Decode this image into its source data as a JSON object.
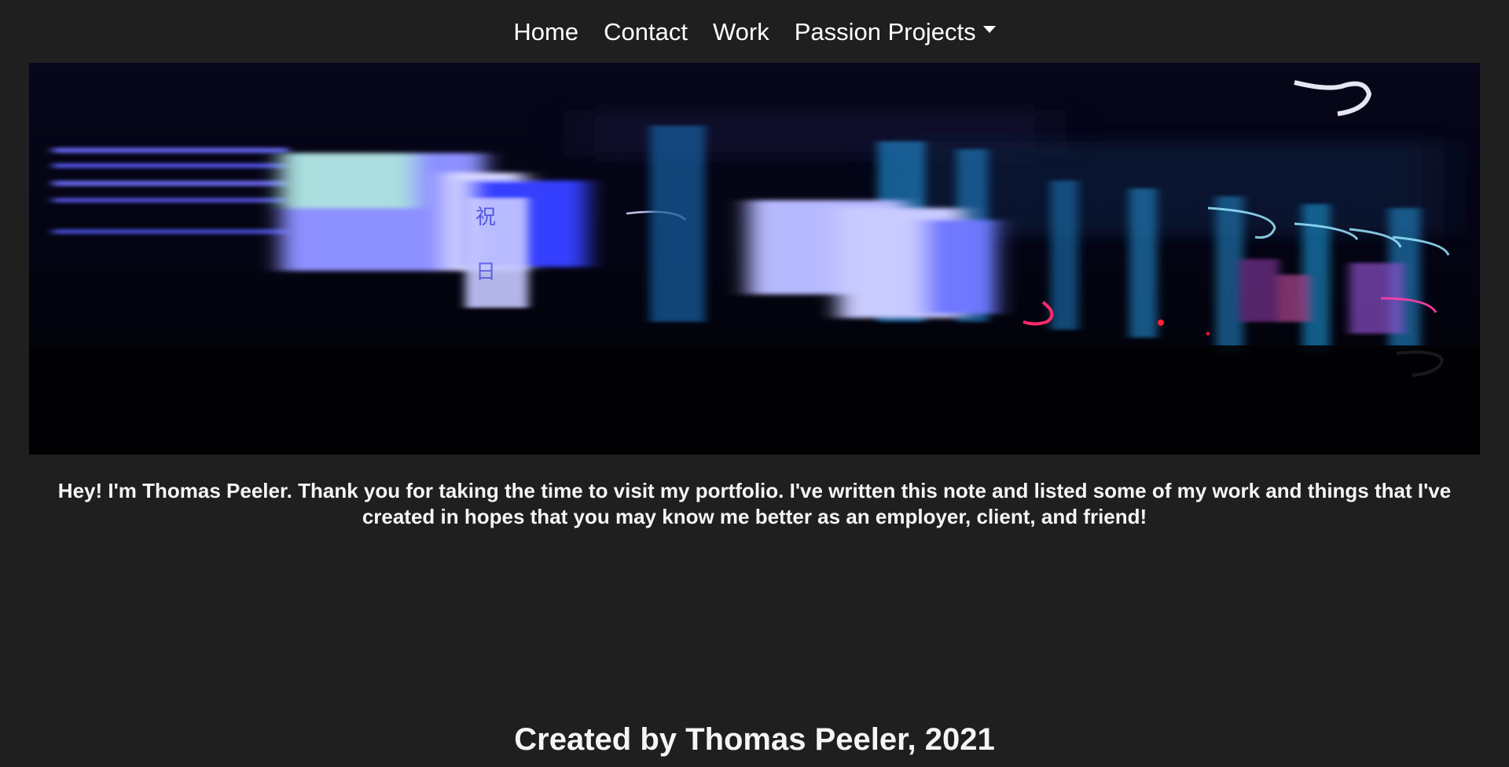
{
  "nav": {
    "items": [
      {
        "label": "Home"
      },
      {
        "label": "Contact"
      },
      {
        "label": "Work"
      },
      {
        "label": "Passion Projects",
        "has_dropdown": true
      }
    ],
    "dropdown_icon": "caret-down-icon"
  },
  "hero": {
    "sign_text_1": "祝",
    "sign_text_2": "日"
  },
  "intro": {
    "text": "Hey! I'm Thomas Peeler. Thank you for taking the time to visit my portfolio. I've written this note and listed some of my work and things that I've created in hopes that you may know me better as an employer, client, and friend!"
  },
  "footer": {
    "text": "Created by Thomas Peeler, 2021"
  },
  "colors": {
    "background": "#1f1f1f",
    "text": "#ffffff",
    "hero_base": "#020209",
    "neon_blue": "#3a3cff",
    "neon_cyan": "#18a4d8",
    "neon_pink": "#ff2a6a"
  }
}
